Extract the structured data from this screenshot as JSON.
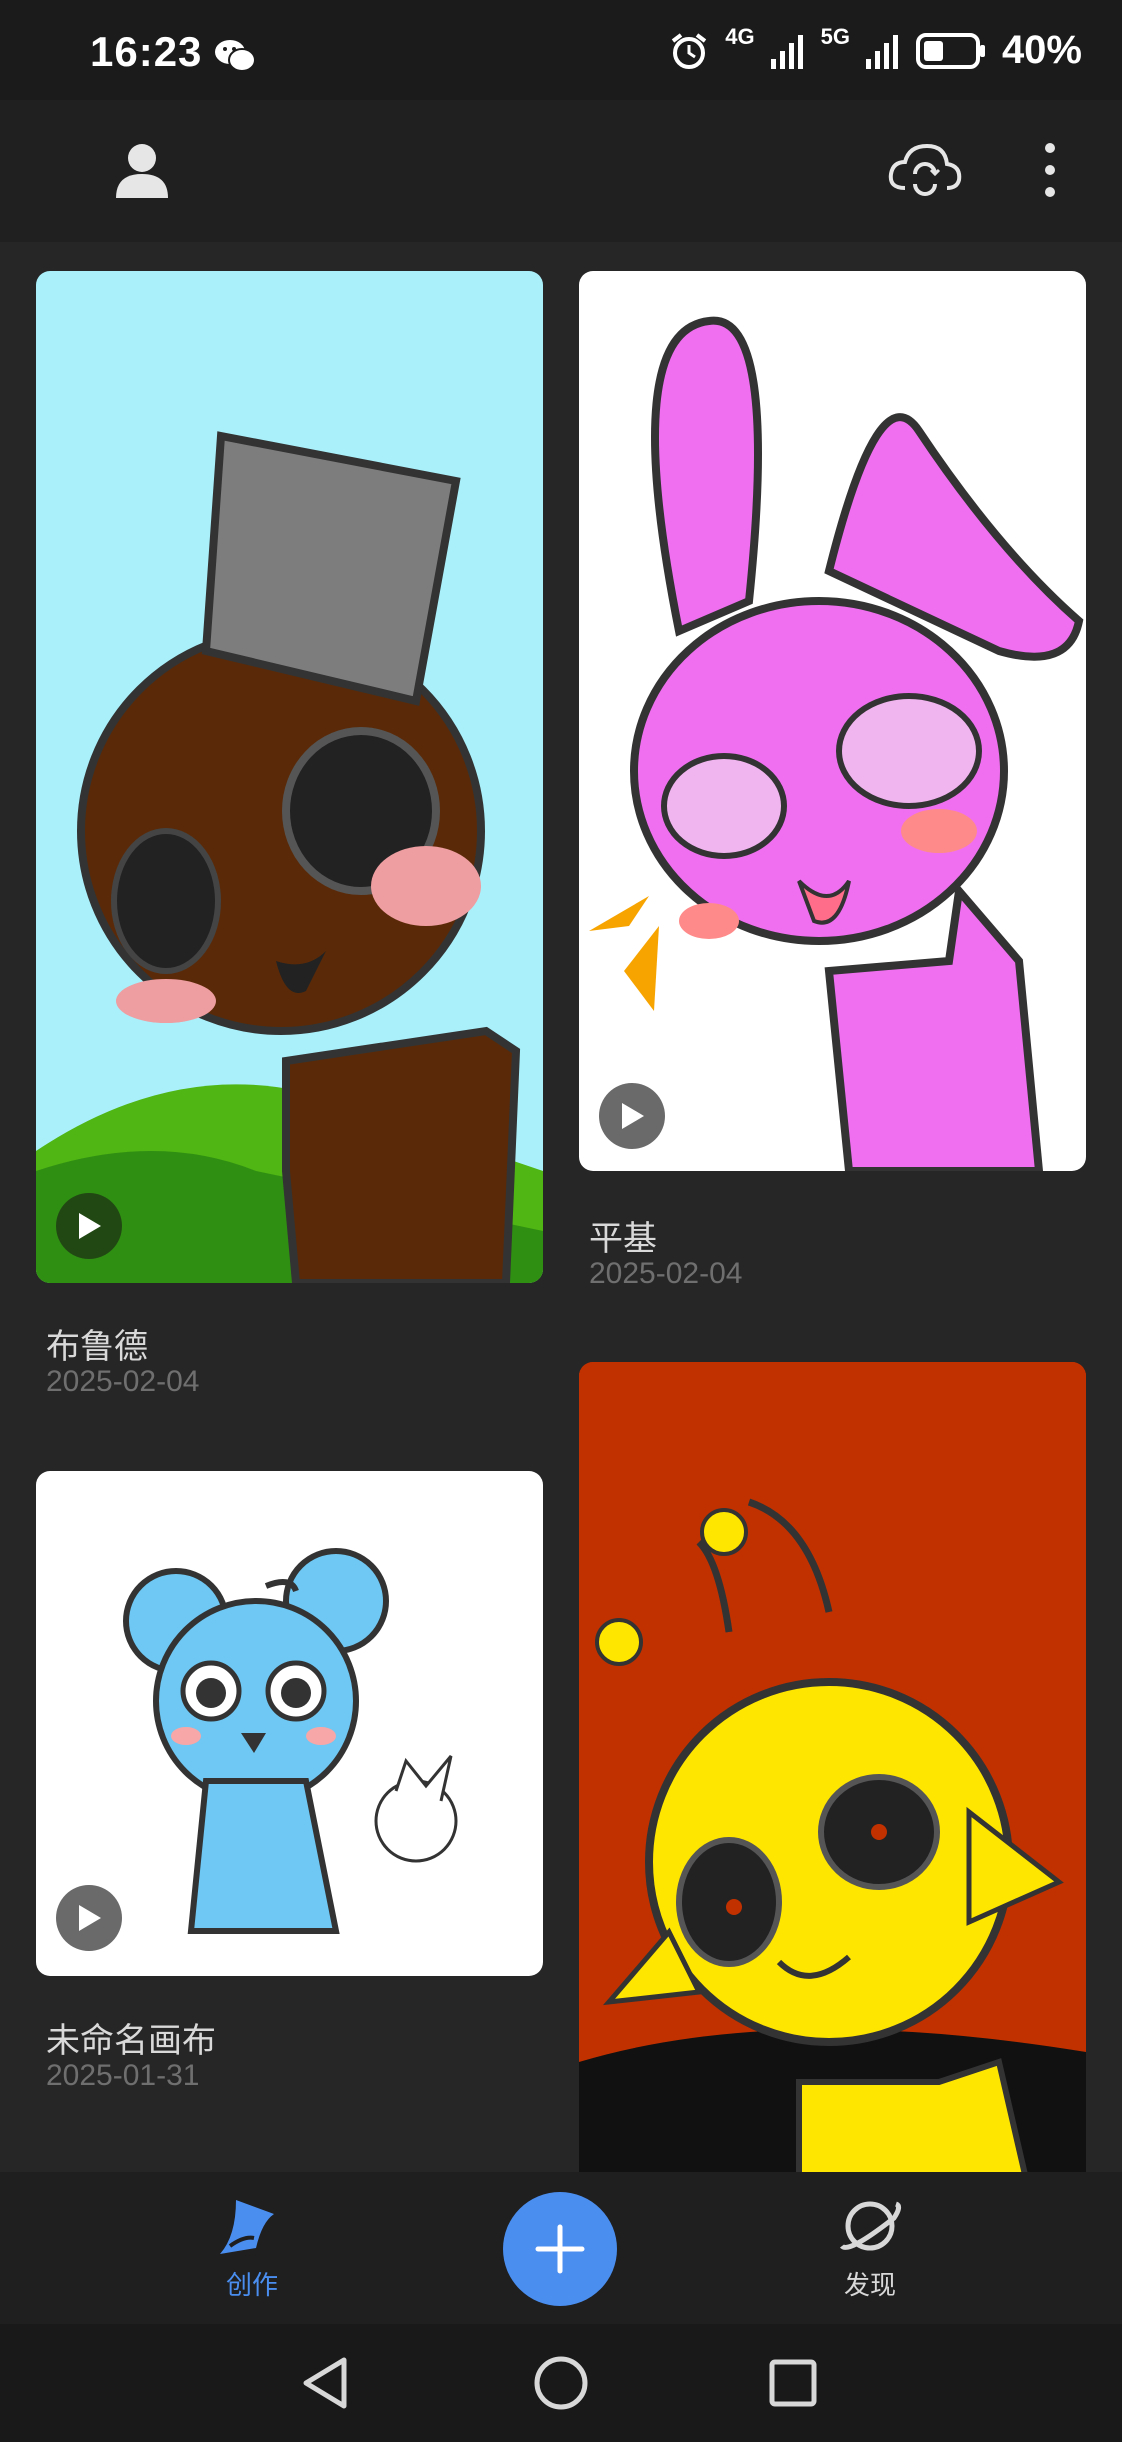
{
  "status_bar": {
    "time": "16:23",
    "net1": "4G",
    "net2": "5G",
    "battery": "40%",
    "battery_level": 0.4
  },
  "toolbar": {
    "profile_icon": "user-icon",
    "sync_icon": "cloud-sync-icon",
    "menu_icon": "more-vertical-icon"
  },
  "artworks": [
    {
      "title": "布鲁德",
      "date": "2025-02-04",
      "bg": "#a9f0fb"
    },
    {
      "title": "平基",
      "date": "2025-02-04",
      "bg": "#ffffff"
    },
    {
      "title": "未命名画布",
      "date": "2025-01-31",
      "bg": "#ffffff"
    },
    {
      "title": "",
      "date": "",
      "bg": "#c13100"
    }
  ],
  "bottom_nav": {
    "create_label": "创作",
    "discover_label": "发现",
    "active_color": "#4a8ef0",
    "fab_icon": "plus-icon"
  }
}
